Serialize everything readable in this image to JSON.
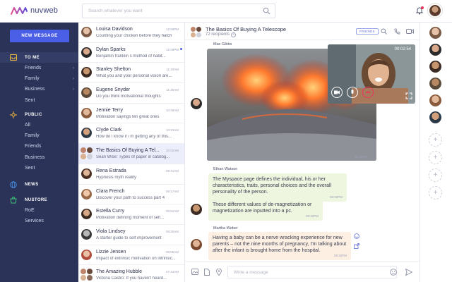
{
  "app": {
    "brand": "nuvweb"
  },
  "search": {
    "placeholder": "Search whatever you want"
  },
  "sidebar": {
    "new_message": "NEW MESSAGE",
    "to_me": {
      "label": "TO ME",
      "items": [
        "Friends",
        "Family",
        "Business",
        "Sent"
      ]
    },
    "public": {
      "label": "PUBLIC",
      "items": [
        "All",
        "Family",
        "Friends",
        "Business",
        "Sent"
      ]
    },
    "news": {
      "label": "NEWS"
    },
    "nustore": {
      "label": "NUSTORE",
      "items": [
        "RoE",
        "Services"
      ]
    }
  },
  "conversations": [
    {
      "name": "Louisa Davidson",
      "snippet": "Counting your chicken before they hatch",
      "time": "12:56PM"
    },
    {
      "name": "Dylan Sparks",
      "snippet": "Benjamin franklin s method of habit...",
      "time": "12:08PM"
    },
    {
      "name": "Stanley Shelton",
      "snippet": "What you and your personal vision are...",
      "time": "11:40AM"
    },
    {
      "name": "Eugene Snyder",
      "snippet": "Do you think motivational thoughts",
      "time": "11:15AM"
    },
    {
      "name": "Jennie Terry",
      "snippet": "Motivation sayings ten great ones",
      "time": "10:48AM"
    },
    {
      "name": "Clyde Clark",
      "snippet": "How do i know if i m getting any of this...",
      "time": "10:23AM"
    },
    {
      "name": "The Basics Of Buying A Tel...",
      "snippet": "Sean Wise: Types of paper in catalog...",
      "time": "10:02AM"
    },
    {
      "name": "Rena Estrada",
      "snippet": "Hypnosis myth reality",
      "time": "09:41AM"
    },
    {
      "name": "Clara French",
      "snippet": "Discover your path to success part 4",
      "time": "09:17AM"
    },
    {
      "name": "Estella Curry",
      "snippet": "Motivation defining moment of self...",
      "time": "08:52AM"
    },
    {
      "name": "Viola Lindsey",
      "snippet": "A starter guide to self improvement",
      "time": "08:30AM"
    },
    {
      "name": "Lizzie Jensen",
      "snippet": "Impact of extrinsic motivation on intrinsic...",
      "time": "08:06AM"
    },
    {
      "name": "The Amazing Hubble",
      "snippet": "Victoria Castro: If you haven't heard...",
      "time": "07:44AM"
    }
  ],
  "chat": {
    "title": "The Basics Of Buying A Telescope",
    "recipients": "72 recipients",
    "tag": "FRIENDS",
    "messages": [
      {
        "sender": "Max Gibbs",
        "time": "08:32PM"
      },
      {
        "sender": "Ethan Watson",
        "text": "The Myspace page defines the individual, his or her characteristics, traits, personal choices and the overall personality of the person.",
        "time": "08:32PM"
      },
      {
        "text": "These different values of de-magnetization or magnetization are inputted into a pc.",
        "time": "08:32PM"
      },
      {
        "sender": "Martha Weber",
        "text": "Having a baby can be a nerve wracking experience for new parents – not the nine months of pregnancy, I'm talking about after the infant is brought home from the hospital.",
        "time": "08:32PM"
      }
    ]
  },
  "video_call": {
    "duration": "00:02:54"
  },
  "composer": {
    "placeholder": "Write a message"
  },
  "colors": {
    "accent": "#4b5ee6",
    "sidebar": "#2b3458",
    "notify": "#e9345c"
  }
}
